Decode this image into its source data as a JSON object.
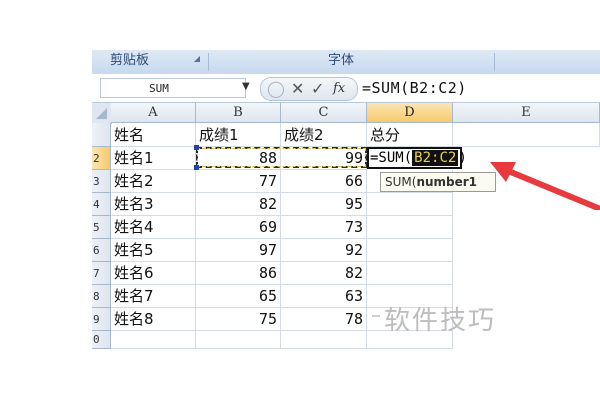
{
  "ribbon": {
    "groups": [
      "剪贴板",
      "字体"
    ]
  },
  "formula_bar": {
    "name_box": "SUM",
    "cancel_symbol": "✕",
    "enter_symbol": "✓",
    "fx_label": "fx",
    "formula": "=SUM(B2:C2)"
  },
  "columns": [
    "A",
    "B",
    "C",
    "D",
    "E"
  ],
  "rows": [
    "",
    "2",
    "3",
    "4",
    "5",
    "6",
    "7",
    "8",
    "9",
    "0"
  ],
  "headers": {
    "name": "姓名",
    "score1": "成绩1",
    "score2": "成绩2",
    "total": "总分"
  },
  "students": [
    {
      "name": "姓名1",
      "score1": "88",
      "score2": "99"
    },
    {
      "name": "姓名2",
      "score1": "77",
      "score2": "66"
    },
    {
      "name": "姓名3",
      "score1": "82",
      "score2": "95"
    },
    {
      "name": "姓名4",
      "score1": "69",
      "score2": "73"
    },
    {
      "name": "姓名5",
      "score1": "97",
      "score2": "92"
    },
    {
      "name": "姓名6",
      "score1": "86",
      "score2": "82"
    },
    {
      "name": "姓名7",
      "score1": "65",
      "score2": "63"
    },
    {
      "name": "姓名8",
      "score1": "75",
      "score2": "78"
    }
  ],
  "editing": {
    "prefix": "=SUM(",
    "range": "B2:C2",
    "suffix": ")"
  },
  "tooltip": {
    "func": "SUM(",
    "arg": "number1"
  },
  "watermark": "软件技巧",
  "colors": {
    "arrow": "#e8393f",
    "active_header": "#f7c96b"
  }
}
